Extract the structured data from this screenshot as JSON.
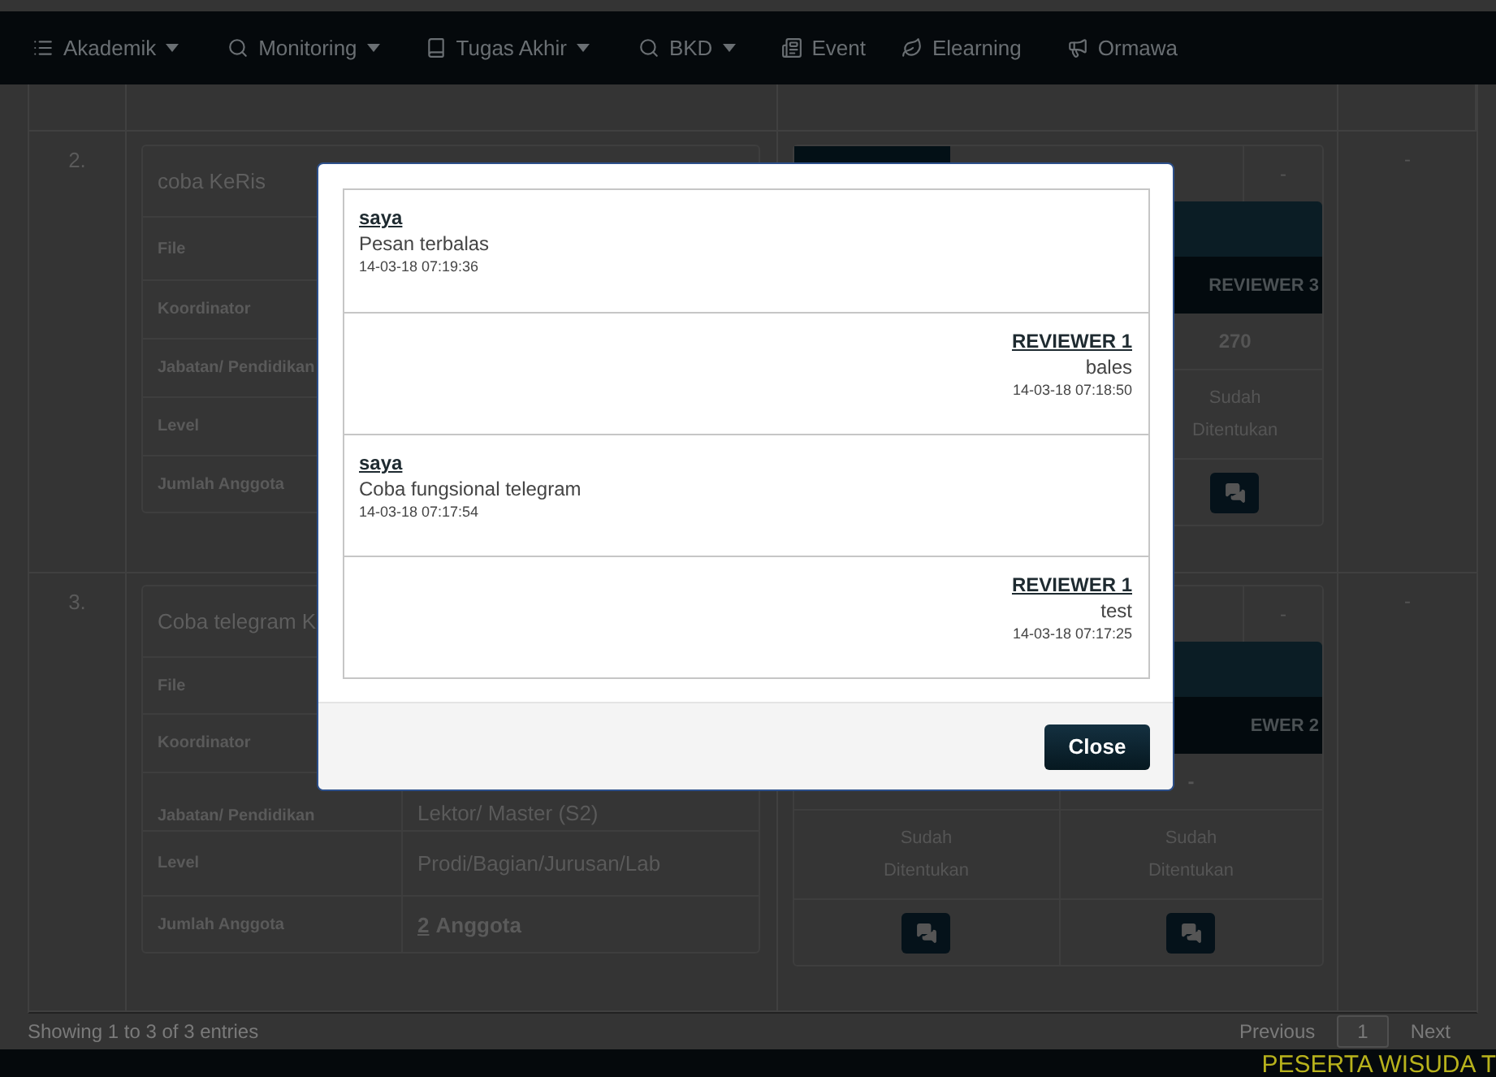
{
  "navbar": {
    "items": [
      {
        "label": "Akademik",
        "dropdown": true
      },
      {
        "label": "Monitoring",
        "dropdown": true
      },
      {
        "label": "Tugas Akhir",
        "dropdown": true
      },
      {
        "label": "BKD",
        "dropdown": true
      },
      {
        "label": "Event",
        "dropdown": false
      },
      {
        "label": "Elearning",
        "dropdown": false
      },
      {
        "label": "Ormawa",
        "dropdown": false
      }
    ]
  },
  "table": {
    "rows": [
      {
        "number": "2.",
        "title": "coba KeRis",
        "fields": [
          {
            "label": "File"
          },
          {
            "label": "Koordinator"
          },
          {
            "label": "Jabatan/ Pendidikan"
          },
          {
            "label": "Level"
          },
          {
            "label": "Jumlah Anggota"
          }
        ],
        "reviewers": {
          "top_block": true,
          "top_value": "-",
          "columns": [
            {
              "header": "REVIEWER 3",
              "value": "270",
              "status": "Sudah Ditentukan",
              "chat": true
            }
          ]
        },
        "last": "-"
      },
      {
        "number": "3.",
        "title": "Coba telegram K",
        "fields": [
          {
            "label": "File"
          },
          {
            "label": "Koordinator"
          },
          {
            "label": "Jabatan/ Pendidikan",
            "value": "Lektor/ Master (S2)"
          },
          {
            "label": "Level",
            "value": "Prodi/Bagian/Jurusan/Lab"
          },
          {
            "label": "Jumlah Anggota",
            "link": "2",
            "value": "Anggota"
          }
        ],
        "reviewers": {
          "top_block": false,
          "top_value": "-",
          "columns": [
            {
              "status": "Sudah Ditentukan",
              "chat": true
            },
            {
              "header": "EWER 2",
              "value": "-",
              "status": "Sudah Ditentukan",
              "chat": true
            }
          ]
        },
        "last": "-"
      }
    ]
  },
  "info": "Showing 1 to 3 of 3 entries",
  "pagination": [
    {
      "label": "Previous",
      "selected": false
    },
    {
      "label": "1",
      "selected": true
    },
    {
      "label": "Next",
      "selected": false
    }
  ],
  "ticker": "PESERTA WISUDA T",
  "modal": {
    "messages": [
      {
        "kind": "sent",
        "sender": "saya",
        "text": "Pesan terbalas",
        "time": "14-03-18 07:19:36"
      },
      {
        "kind": "received",
        "sender": "REVIEWER 1",
        "text": "bales",
        "time": "14-03-18 07:18:50"
      },
      {
        "kind": "sent",
        "sender": "saya",
        "text": "Coba fungsional telegram",
        "time": "14-03-18 07:17:54"
      },
      {
        "kind": "received",
        "sender": "REVIEWER 1",
        "text": "test",
        "time": "14-03-18 07:17:25"
      }
    ],
    "close_button": "Close"
  }
}
